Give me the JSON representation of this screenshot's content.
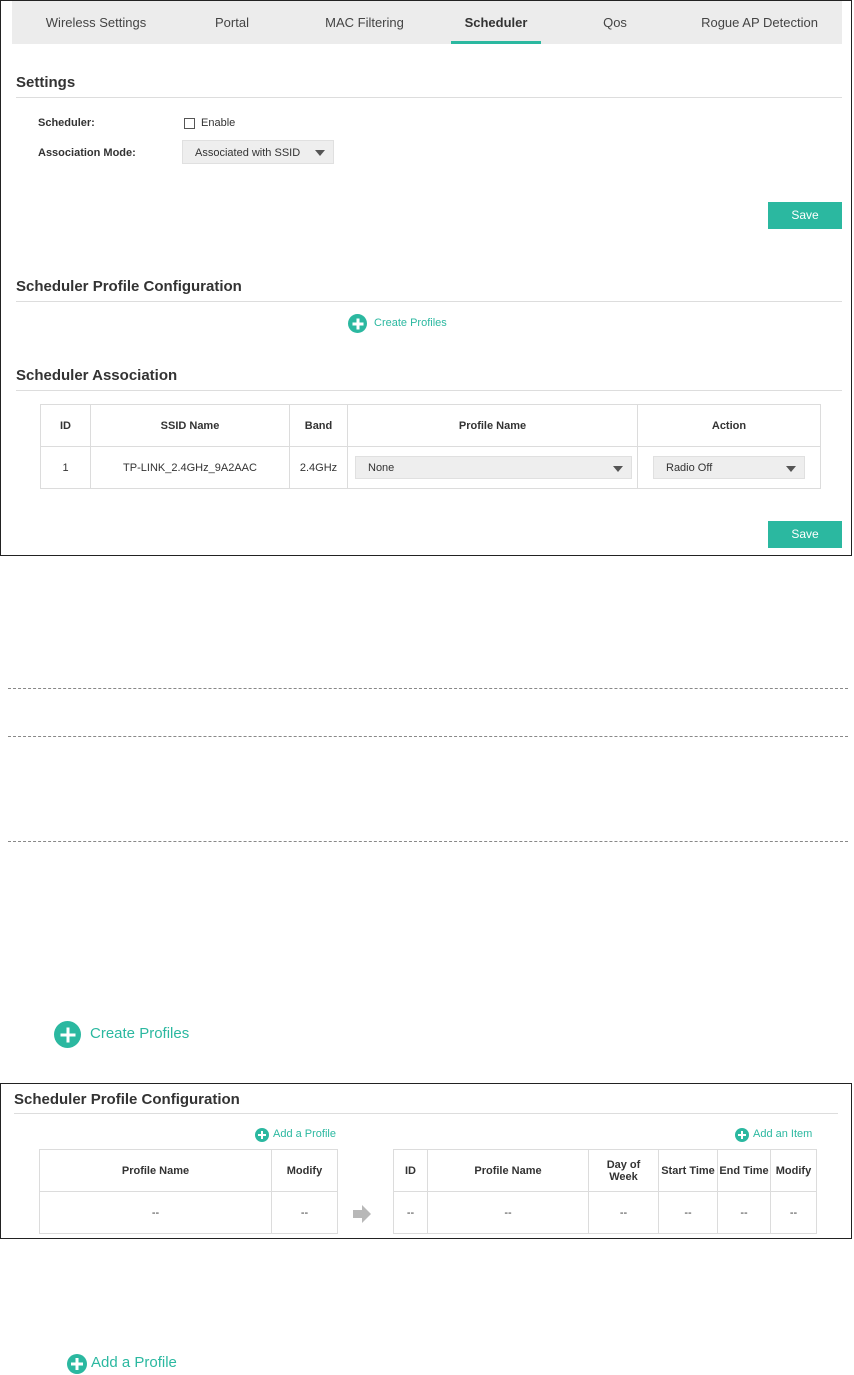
{
  "tabs": [
    "Wireless Settings",
    "Portal",
    "MAC Filtering",
    "Scheduler",
    "Qos",
    "Rogue AP Detection"
  ],
  "active_tab": "Scheduler",
  "settings": {
    "title": "Settings",
    "scheduler_label": "Scheduler:",
    "enable_label": "Enable",
    "enable_checked": false,
    "association_mode_label": "Association Mode:",
    "association_mode_value": "Associated with SSID",
    "save_label": "Save"
  },
  "profile_config": {
    "title": "Scheduler Profile Configuration",
    "create_profiles_label": "Create Profiles"
  },
  "association": {
    "title": "Scheduler Association",
    "columns": [
      "ID",
      "SSID Name",
      "Band",
      "Profile Name",
      "Action"
    ],
    "rows": [
      {
        "id": "1",
        "ssid": "TP-LINK_2.4GHz_9A2AAC",
        "band": "2.4GHz",
        "profile": "None",
        "action": "Radio Off"
      }
    ],
    "save_label": "Save"
  },
  "callout_create_profiles": "Create Profiles",
  "panel2": {
    "title": "Scheduler Profile Configuration",
    "add_profile_label": "Add a Profile",
    "add_item_label": "Add an Item",
    "left_columns": [
      "Profile Name",
      "Modify"
    ],
    "left_row": [
      "--",
      "--"
    ],
    "right_columns": [
      "ID",
      "Profile Name",
      "Day of Week",
      "Start Time",
      "End Time",
      "Modify"
    ],
    "right_row": [
      "--",
      "--",
      "--",
      "--",
      "--",
      "--"
    ]
  },
  "callout_add_profile": "Add a Profile",
  "colors": {
    "accent": "#2bb8a0",
    "tab_bg": "#ececec",
    "select_bg": "#eeeeee"
  }
}
